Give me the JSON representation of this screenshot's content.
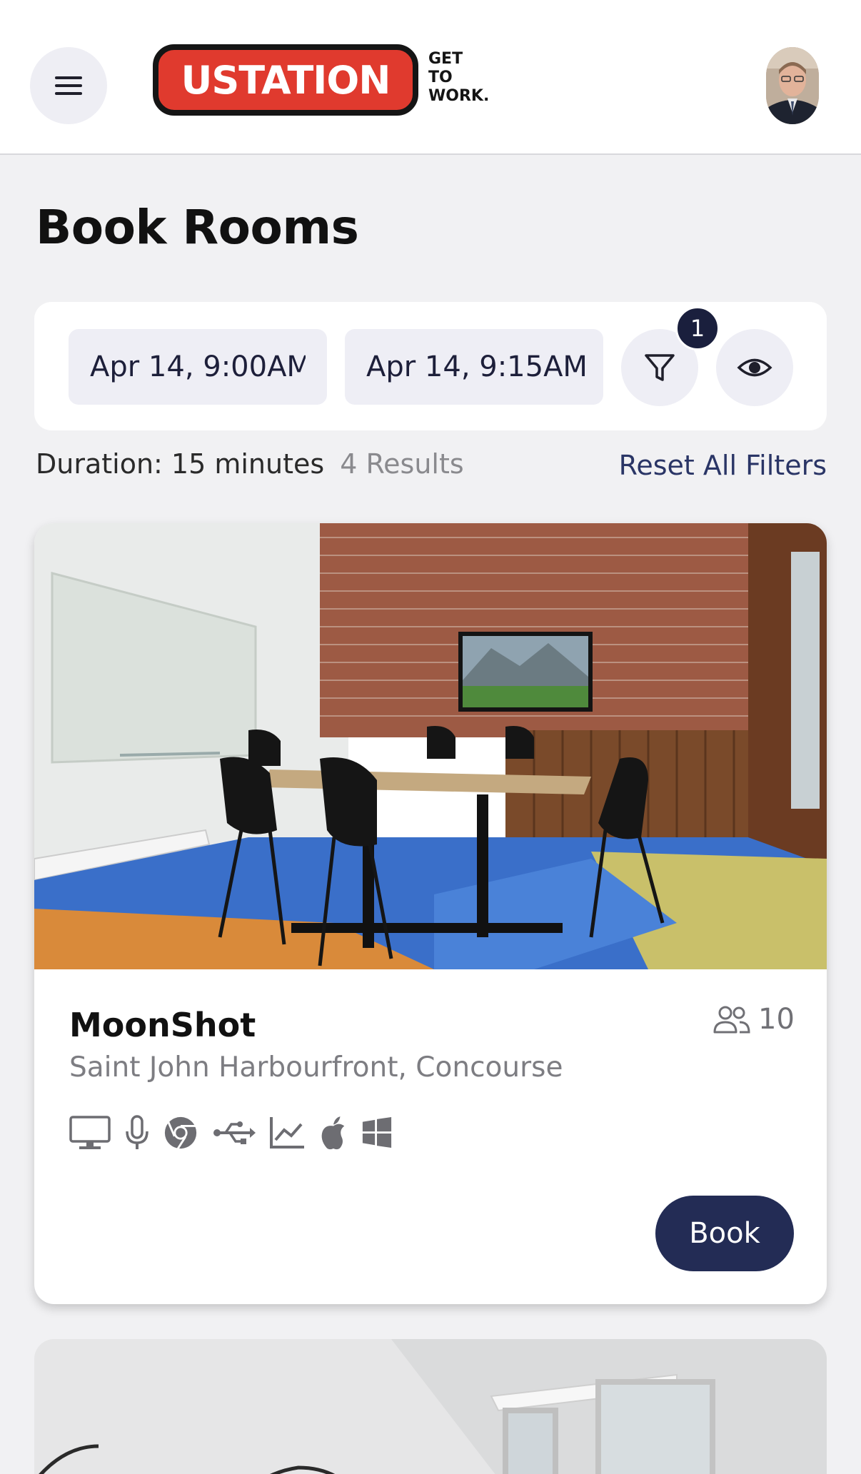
{
  "header": {
    "logo_main": "USTATION",
    "logo_tagline": "GET\nTO\nWORK."
  },
  "page": {
    "title": "Book Rooms"
  },
  "filters": {
    "start": "Apr 14, 9:00AM",
    "end": "Apr 14, 9:15AM",
    "active_filter_count": "1"
  },
  "summary": {
    "duration": "Duration: 15 minutes",
    "results": "4 Results",
    "reset_label": "Reset All Filters"
  },
  "rooms": [
    {
      "name": "MoonShot",
      "location": "Saint John Harbourfront, Concourse",
      "capacity": "10",
      "amenities": [
        "monitor-icon",
        "microphone-icon",
        "chrome-icon",
        "usb-icon",
        "chart-icon",
        "apple-icon",
        "windows-icon"
      ],
      "book_label": "Book"
    }
  ],
  "colors": {
    "accent": "#232c55",
    "badge": "#1a1f3d",
    "background": "#f1f1f3",
    "logo_red": "#e03a2e"
  }
}
